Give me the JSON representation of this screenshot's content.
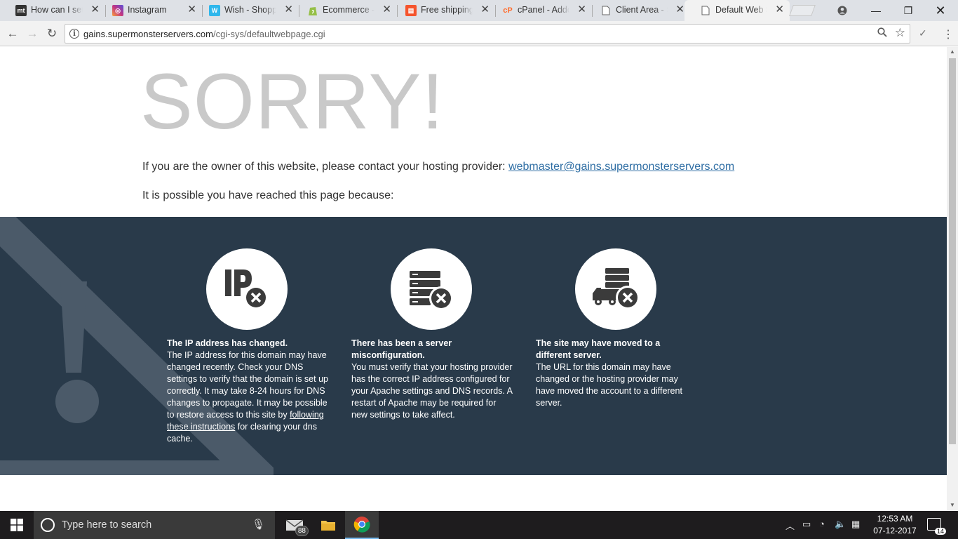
{
  "browser": {
    "tabs": [
      {
        "title": "How can I set u",
        "favicon": "mt",
        "color": "#333333"
      },
      {
        "title": "Instagram",
        "favicon": "instagram-icon",
        "color": "#c13584"
      },
      {
        "title": "Wish - Shoppin",
        "favicon": "W",
        "color": "#2fb7ec"
      },
      {
        "title": "Ecommerce - F",
        "favicon": "shopify-icon",
        "color": "#95bf47"
      },
      {
        "title": "Free shipping o",
        "favicon": "shop-icon",
        "color": "#f5542d"
      },
      {
        "title": "cPanel - Addo",
        "favicon": "cP",
        "color": "#ff6c2c"
      },
      {
        "title": "Client Area - S",
        "favicon": "page-icon",
        "color": "#999999"
      },
      {
        "title": "Default Web S",
        "favicon": "page-icon",
        "color": "#999999"
      }
    ],
    "url": {
      "host": "gains.supermonsterservers.com",
      "path": "/cgi-sys/defaultwebpage.cgi"
    }
  },
  "page": {
    "headline": "SORRY!",
    "contact_text": "If you are the owner of this website, please contact your hosting provider: ",
    "contact_email": "webmaster@gains.supermonsterservers.com",
    "reason_text": "It is possible you have reached this page because:",
    "band_color": "#293a4a",
    "cards": [
      {
        "icon": "ip-error-icon",
        "title": "The IP address has changed.",
        "body_before": "The IP address for this domain may have changed recently. Check your DNS settings to verify that the domain is set up correctly. It may take 8-24 hours for DNS changes to propagate. It may be possible to restore access to this site by ",
        "link": "following these instructions",
        "body_after": " for clearing your dns cache."
      },
      {
        "icon": "server-error-icon",
        "title": "There has been a server misconfiguration.",
        "body_before": "You must verify that your hosting provider has the correct IP address configured for your Apache settings and DNS records. A restart of Apache may be required for new settings to take affect.",
        "link": "",
        "body_after": ""
      },
      {
        "icon": "moved-server-icon",
        "title": "The site may have moved to a different server.",
        "body_before": "The URL for this domain may have changed or the hosting provider may have moved the account to a different server.",
        "link": "",
        "body_after": ""
      }
    ]
  },
  "taskbar": {
    "search_placeholder": "Type here to search",
    "mail_badge": "88",
    "time": "12:53 AM",
    "date": "07-12-2017",
    "notification_count": "14"
  }
}
